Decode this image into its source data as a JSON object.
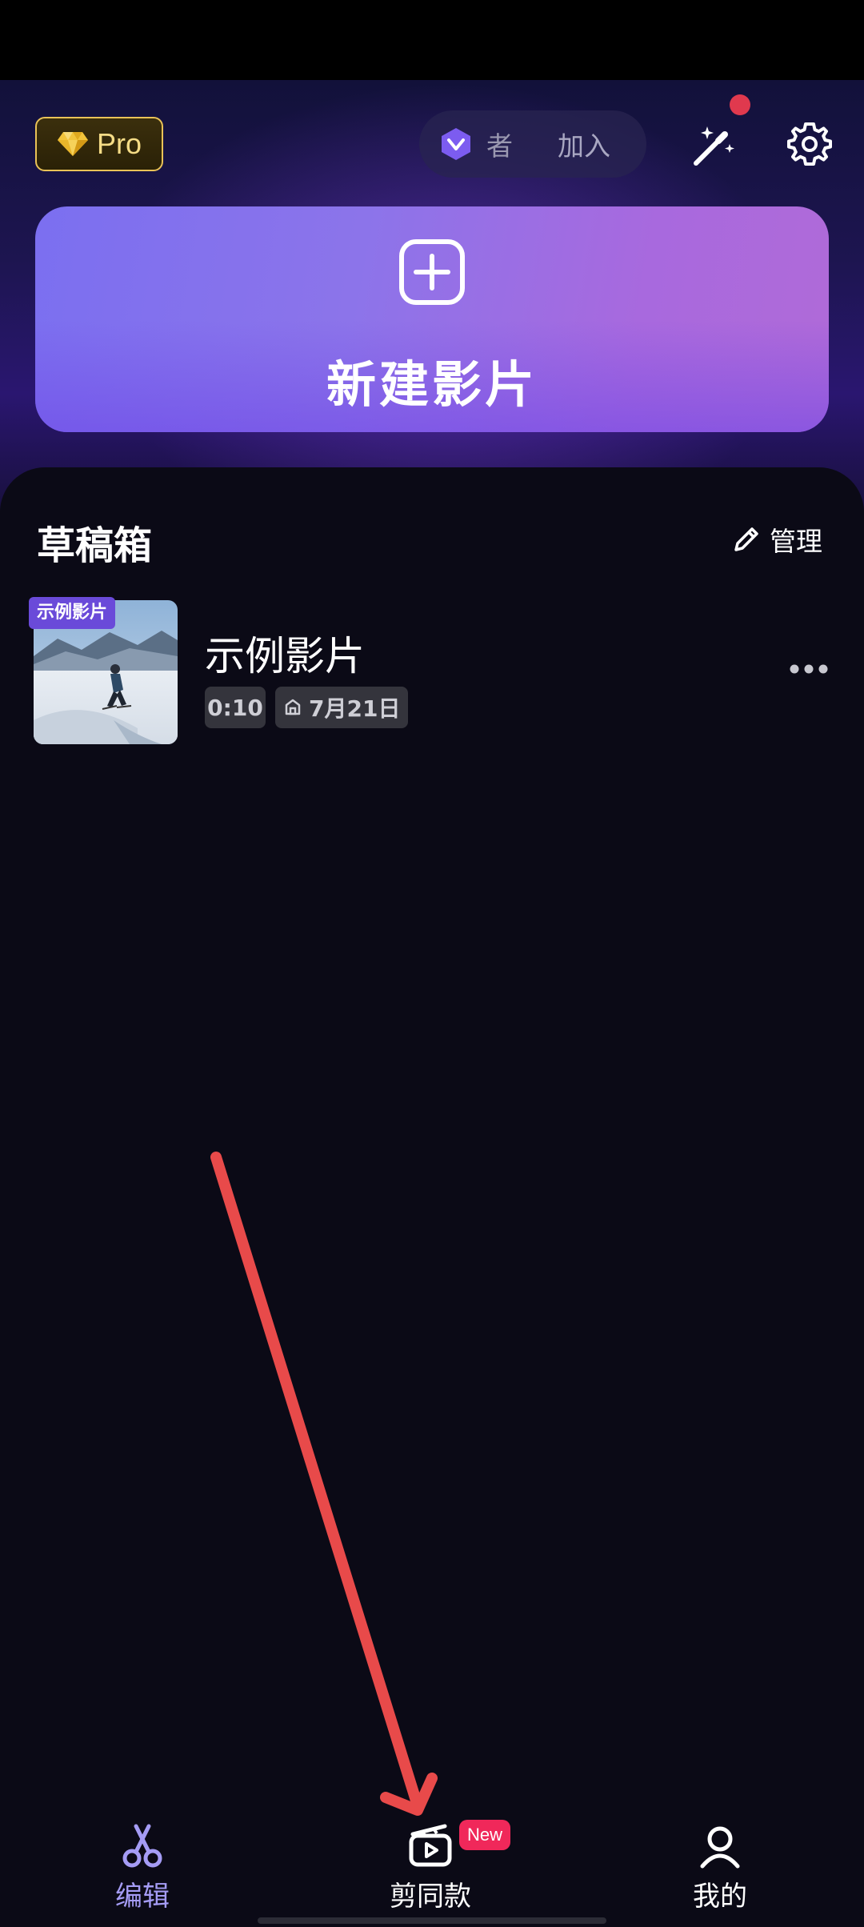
{
  "header": {
    "pro_label": "Pro",
    "creator_text_a": "者",
    "creator_text_b": "加入",
    "notification_dot": true
  },
  "new_project": {
    "label": "新建影片"
  },
  "drafts": {
    "title": "草稿箱",
    "manage_label": "管理",
    "items": [
      {
        "badge": "示例影片",
        "name": "示例影片",
        "duration": "0:10",
        "date": "7月21日"
      }
    ]
  },
  "bottom_nav": {
    "items": [
      {
        "label": "编辑",
        "icon": "scissors-icon",
        "active": true
      },
      {
        "label": "剪同款",
        "icon": "template-clapper-icon",
        "active": false,
        "tag": "New"
      },
      {
        "label": "我的",
        "icon": "user-icon",
        "active": false
      }
    ]
  },
  "colors": {
    "accent": "#a59cf5",
    "pro_gold": "#e9c257",
    "new_tag": "#f0285a",
    "background": "#0b0a16",
    "arrow": "#e84a4a"
  }
}
